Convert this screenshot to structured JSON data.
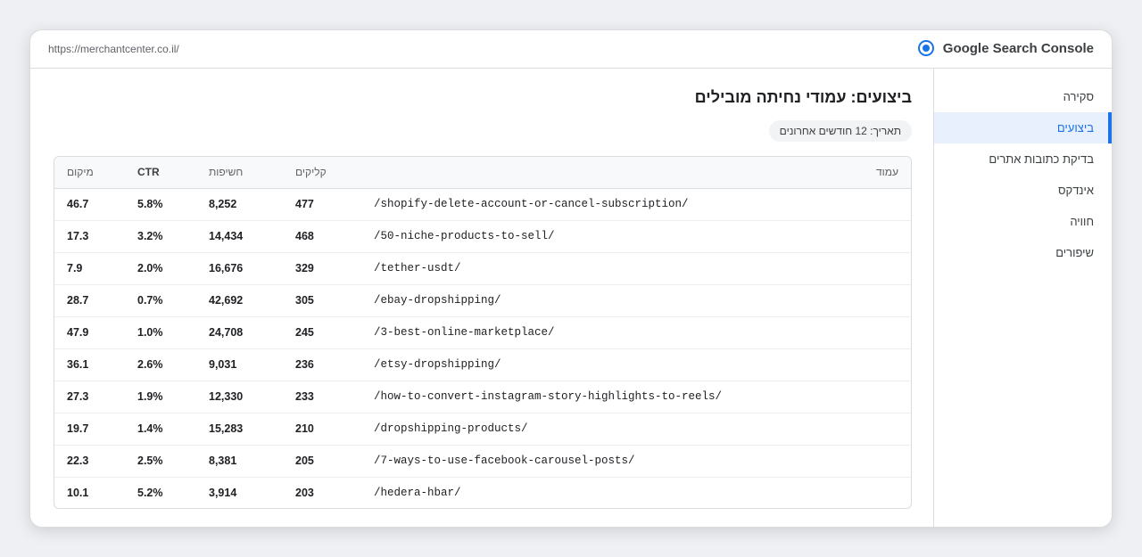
{
  "header": {
    "url": "https://merchantcenter.co.il/",
    "brand": "Google Search Console",
    "brand_icon": "search-console-logo-icon",
    "accent": "#1a73e8"
  },
  "sidebar": {
    "items": [
      {
        "label": "סקירה",
        "active": false
      },
      {
        "label": "ביצועים",
        "active": true
      },
      {
        "label": "בדיקת כתובות אתרים",
        "active": false
      },
      {
        "label": "אינדקס",
        "active": false
      },
      {
        "label": "חוויה",
        "active": false
      },
      {
        "label": "שיפורים",
        "active": false
      }
    ]
  },
  "main": {
    "title": "ביצועים: עמודי נחיתה מובילים",
    "date_chip": "תאריך: 12 חודשים אחרונים",
    "table": {
      "columns": {
        "position": "מיקום",
        "ctr": "CTR",
        "impressions": "חשיפות",
        "clicks": "קליקים",
        "page": "עמוד"
      },
      "rows": [
        {
          "position": "46.7",
          "ctr": "5.8%",
          "impressions": "8,252",
          "clicks": "477",
          "page": "/shopify-delete-account-or-cancel-subscription/"
        },
        {
          "position": "17.3",
          "ctr": "3.2%",
          "impressions": "14,434",
          "clicks": "468",
          "page": "/50-niche-products-to-sell/"
        },
        {
          "position": "7.9",
          "ctr": "2.0%",
          "impressions": "16,676",
          "clicks": "329",
          "page": "/tether-usdt/"
        },
        {
          "position": "28.7",
          "ctr": "0.7%",
          "impressions": "42,692",
          "clicks": "305",
          "page": "/ebay-dropshipping/"
        },
        {
          "position": "47.9",
          "ctr": "1.0%",
          "impressions": "24,708",
          "clicks": "245",
          "page": "/3-best-online-marketplace/"
        },
        {
          "position": "36.1",
          "ctr": "2.6%",
          "impressions": "9,031",
          "clicks": "236",
          "page": "/etsy-dropshipping/"
        },
        {
          "position": "27.3",
          "ctr": "1.9%",
          "impressions": "12,330",
          "clicks": "233",
          "page": "/how-to-convert-instagram-story-highlights-to-reels/"
        },
        {
          "position": "19.7",
          "ctr": "1.4%",
          "impressions": "15,283",
          "clicks": "210",
          "page": "/dropshipping-products/"
        },
        {
          "position": "22.3",
          "ctr": "2.5%",
          "impressions": "8,381",
          "clicks": "205",
          "page": "/7-ways-to-use-facebook-carousel-posts/"
        },
        {
          "position": "10.1",
          "ctr": "5.2%",
          "impressions": "3,914",
          "clicks": "203",
          "page": "/hedera-hbar/"
        }
      ]
    }
  }
}
